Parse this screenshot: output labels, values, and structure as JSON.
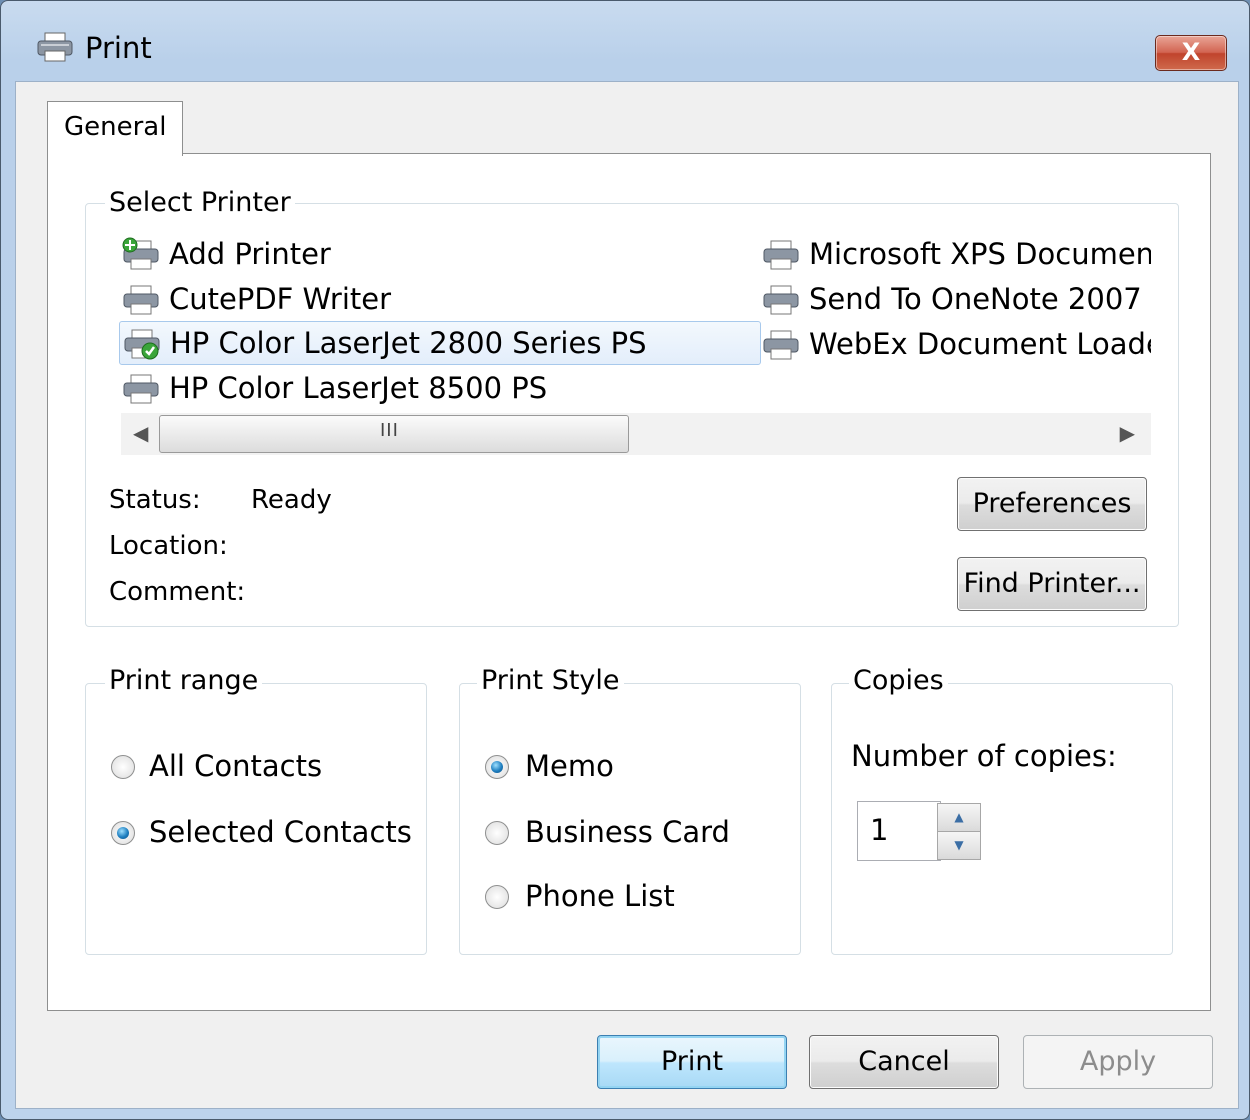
{
  "window": {
    "title": "Print",
    "close_label": "X"
  },
  "tabs": [
    {
      "label": "General"
    }
  ],
  "select_printer": {
    "legend": "Select Printer",
    "printers": [
      {
        "name": "Add Printer",
        "icon": "add-printer-icon"
      },
      {
        "name": "CutePDF Writer",
        "icon": "printer-icon"
      },
      {
        "name": "HP Color LaserJet 2800 Series PS",
        "icon": "default-printer-icon",
        "selected": true
      },
      {
        "name": "HP Color LaserJet 8500 PS",
        "icon": "printer-icon"
      },
      {
        "name": "Microsoft XPS Document Writer",
        "icon": "printer-icon"
      },
      {
        "name": "Send To OneNote 2007",
        "icon": "printer-icon"
      },
      {
        "name": "WebEx Document Loader",
        "icon": "printer-icon"
      }
    ],
    "scroll_grip": "III",
    "status_label": "Status:",
    "status_value": "Ready",
    "location_label": "Location:",
    "comment_label": "Comment:",
    "preferences_label": "Preferences",
    "find_printer_label": "Find Printer..."
  },
  "print_range": {
    "legend": "Print range",
    "options": [
      {
        "label": "All Contacts",
        "checked": false
      },
      {
        "label": "Selected Contacts",
        "checked": true
      }
    ]
  },
  "print_style": {
    "legend": "Print Style",
    "options": [
      {
        "label": "Memo",
        "checked": true
      },
      {
        "label": "Business Card",
        "checked": false
      },
      {
        "label": "Phone List",
        "checked": false
      }
    ]
  },
  "copies": {
    "legend": "Copies",
    "number_label": "Number of copies:",
    "value": "1"
  },
  "footer": {
    "print_label": "Print",
    "cancel_label": "Cancel",
    "apply_label": "Apply"
  },
  "colors": {
    "accent": "#1f7fc0",
    "selection": "#e3eefb",
    "close_red": "#c0442d"
  }
}
